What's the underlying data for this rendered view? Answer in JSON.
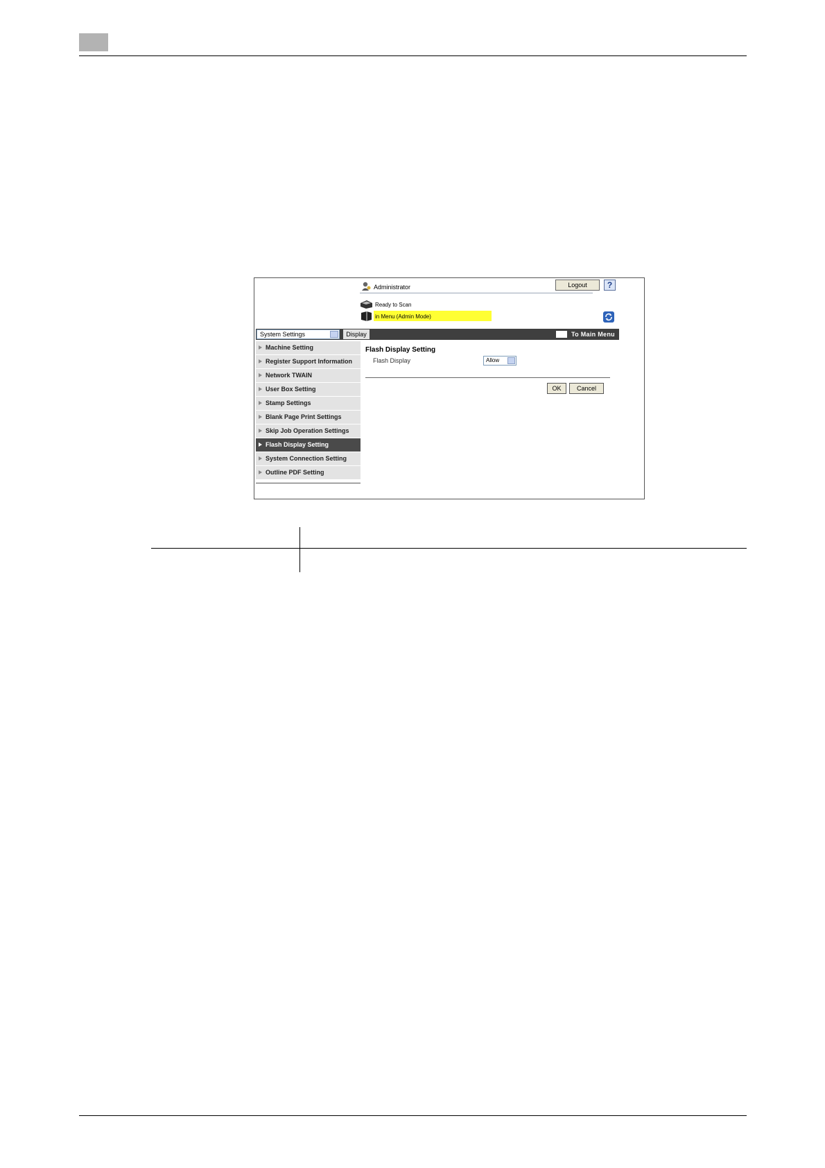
{
  "window": {
    "user_label": "Administrator",
    "logout_label": "Logout",
    "help_label": "?",
    "status_lines": [
      "Ready to Scan",
      "in Menu (Admin Mode)"
    ]
  },
  "toolbar": {
    "category_select": "System Settings",
    "display_tab": "Display",
    "main_menu_link": "To Main Menu"
  },
  "sidebar": {
    "items": [
      {
        "label": "Machine Setting",
        "active": false
      },
      {
        "label": "Register Support Information",
        "active": false
      },
      {
        "label": "Network TWAIN",
        "active": false
      },
      {
        "label": "User Box Setting",
        "active": false
      },
      {
        "label": "Stamp Settings",
        "active": false
      },
      {
        "label": "Blank Page Print Settings",
        "active": false
      },
      {
        "label": "Skip Job Operation Settings",
        "active": false
      },
      {
        "label": "Flash Display Setting",
        "active": true
      },
      {
        "label": "System Connection Setting",
        "active": false
      },
      {
        "label": "Outline PDF Setting",
        "active": false
      }
    ]
  },
  "content": {
    "title": "Flash Display Setting",
    "field_label": "Flash Display",
    "field_value": "Allow",
    "ok_label": "OK",
    "cancel_label": "Cancel"
  },
  "colors": {
    "highlight": "#ffff33",
    "menu_bar": "#3f3f3f",
    "active_item": "#4a4a4a"
  }
}
